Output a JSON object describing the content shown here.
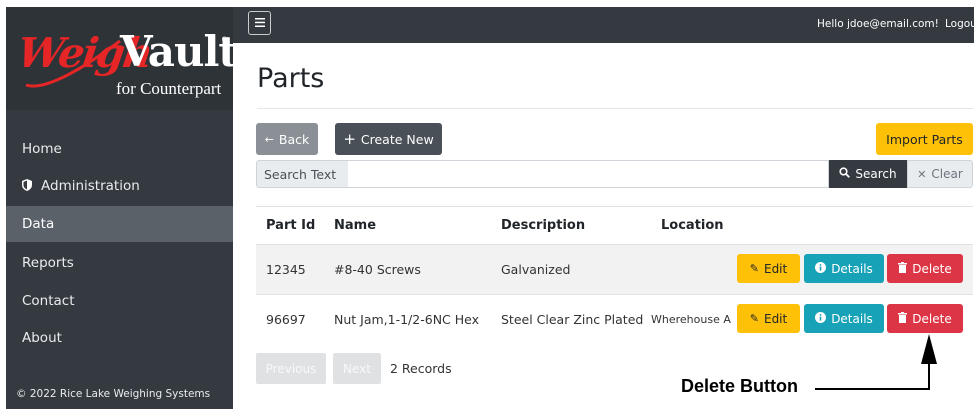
{
  "brand": {
    "logo_main": "Weigh",
    "logo_vault": "Vault",
    "logo_sub": "for Counterpart",
    "logo_reg": "®"
  },
  "sidebar": {
    "items": [
      {
        "label": "Home",
        "icon": "",
        "active": false
      },
      {
        "label": "Administration",
        "icon": "shield-icon",
        "active": false
      },
      {
        "label": "Data",
        "icon": "",
        "active": true
      },
      {
        "label": "Reports",
        "icon": "",
        "active": false
      },
      {
        "label": "Contact",
        "icon": "",
        "active": false
      },
      {
        "label": "About",
        "icon": "",
        "active": false
      }
    ],
    "copyright": "© 2022 Rice Lake Weighing Systems"
  },
  "topbar": {
    "greeting": "Hello jdoe@email.com!",
    "logout": "Logout"
  },
  "page": {
    "title": "Parts"
  },
  "toolbar": {
    "back_label": "Back",
    "create_label": "Create New",
    "import_label": "Import Parts"
  },
  "search": {
    "label": "Search Text",
    "value": "",
    "search_label": "Search",
    "clear_label": "Clear"
  },
  "table": {
    "headers": [
      "Part Id",
      "Name",
      "Description",
      "Location"
    ],
    "rows": [
      {
        "part_id": "12345",
        "name": "#8-40 Screws",
        "description": "Galvanized",
        "location": ""
      },
      {
        "part_id": "96697",
        "name": "Nut Jam,1-1/2-6NC Hex",
        "description": "Steel Clear Zinc Plated",
        "location": "Wherehouse A"
      }
    ],
    "actions": {
      "edit": "Edit",
      "details": "Details",
      "delete": "Delete"
    }
  },
  "pager": {
    "previous": "Previous",
    "next": "Next",
    "records": "2 Records"
  },
  "annotation": {
    "callout": "Delete Button"
  },
  "colors": {
    "sidebar_bg": "#343a40",
    "active_nav": "#5a6168",
    "edit": "#ffc107",
    "details": "#17a2b8",
    "delete": "#dc3545",
    "logo_red": "#e52526"
  }
}
